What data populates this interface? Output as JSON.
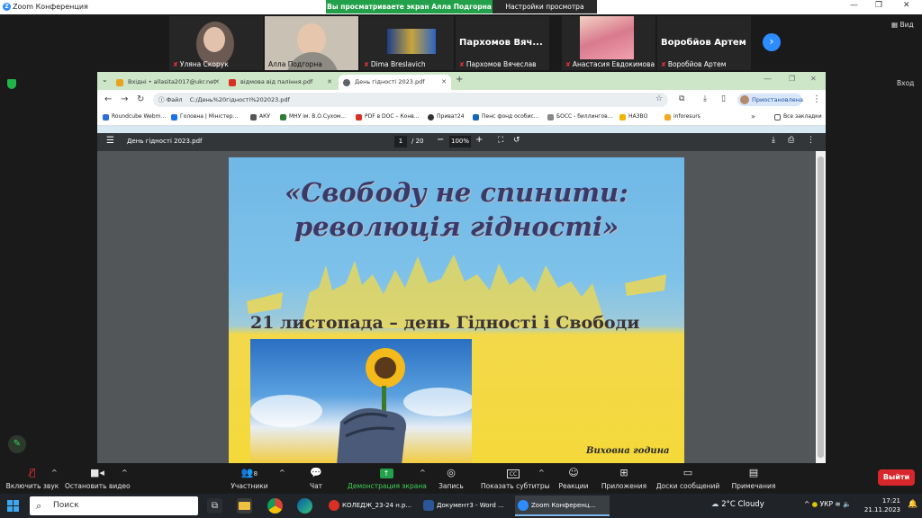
{
  "window": {
    "title": "Zoom Конференция",
    "share_banner": "Вы просматриваете экран Алла Подгорна",
    "view_settings": "Настройки просмотра",
    "view_label": "Вид",
    "entry_label": "Вход"
  },
  "participants": [
    {
      "name": "Уляна Скорук",
      "muted": true,
      "kind": "video"
    },
    {
      "name": "Алла Подгорна",
      "muted": false,
      "kind": "video"
    },
    {
      "name": "Dima Breslavich",
      "muted": true,
      "kind": "video"
    },
    {
      "name": "Пархомов Вячеслав",
      "display": "Пархомов Вяч...",
      "muted": true,
      "kind": "name"
    },
    {
      "name": "Анастасия Евдокимова",
      "muted": true,
      "kind": "video"
    },
    {
      "name": "Воробйов Артем",
      "display": "Воробйов Артем",
      "muted": true,
      "kind": "name"
    }
  ],
  "browser": {
    "tabs": [
      {
        "title": "Вхідні • allasita2017@ukr.net",
        "icon_color": "#e8a21c"
      },
      {
        "title": "відмова від паління.pdf",
        "icon_color": "#d93025"
      },
      {
        "title": "День гідності 2023.pdf",
        "icon_color": "#5f6368",
        "active": true
      }
    ],
    "omnibox_badge": "Файл",
    "url": "C:/День%20гідності%202023.pdf",
    "profile": "Приостановлена",
    "bookmarks": [
      {
        "label": "Roundcube Webm...",
        "color": "#2a6fd6"
      },
      {
        "label": "Головна | Міністер...",
        "color": "#1a73e8"
      },
      {
        "label": "АКУ",
        "color": "#555555"
      },
      {
        "label": "МНУ ім. В.О.Сухом...",
        "color": "#2e7d32"
      },
      {
        "label": "PDF в DOC – Конв...",
        "color": "#d93025"
      },
      {
        "label": "Приват24",
        "color": "#333333"
      },
      {
        "label": "Пенс фонд особис...",
        "color": "#1565c0"
      },
      {
        "label": "БОСС - биллингов...",
        "color": "#888888"
      },
      {
        "label": "НАЗВО",
        "color": "#f0b400"
      },
      {
        "label": "inforesurs",
        "color": "#f5a623"
      }
    ],
    "all_bookmarks": "Все закладки"
  },
  "pdf": {
    "title": "День гідності 2023.pdf",
    "page_current": "1",
    "page_total": "/ 20",
    "zoom": "100%"
  },
  "slide": {
    "title_line1": "«Свободу не спинити:",
    "title_line2": "революція гідності»",
    "subtitle": "21 листопада – день Гідності і Свободи",
    "footer": "Виховна година"
  },
  "controls": {
    "audio": "Включить звук",
    "video": "Остановить видео",
    "participants": "Участники",
    "participants_count": "8",
    "chat": "Чат",
    "share": "Демонстрация экрана",
    "record": "Запись",
    "captions": "Показать субтитры",
    "reactions": "Реакции",
    "apps": "Приложения",
    "whiteboards": "Доски сообщений",
    "notes": "Примечания",
    "leave": "Выйти"
  },
  "taskbar": {
    "search": "Поиск",
    "apps": [
      {
        "label": "КОЛЕДЖ_23-24 н.р...",
        "color": "#d93025"
      },
      {
        "label": "Документ3 - Word ...",
        "color": "#2b579a"
      },
      {
        "label": "Zoom Конференц...",
        "color": "#2d8cff",
        "active": true
      }
    ],
    "weather_temp": "2°C",
    "weather_desc": "Cloudy",
    "language": "УКР",
    "time": "17:21",
    "date": "21.11.2023"
  }
}
